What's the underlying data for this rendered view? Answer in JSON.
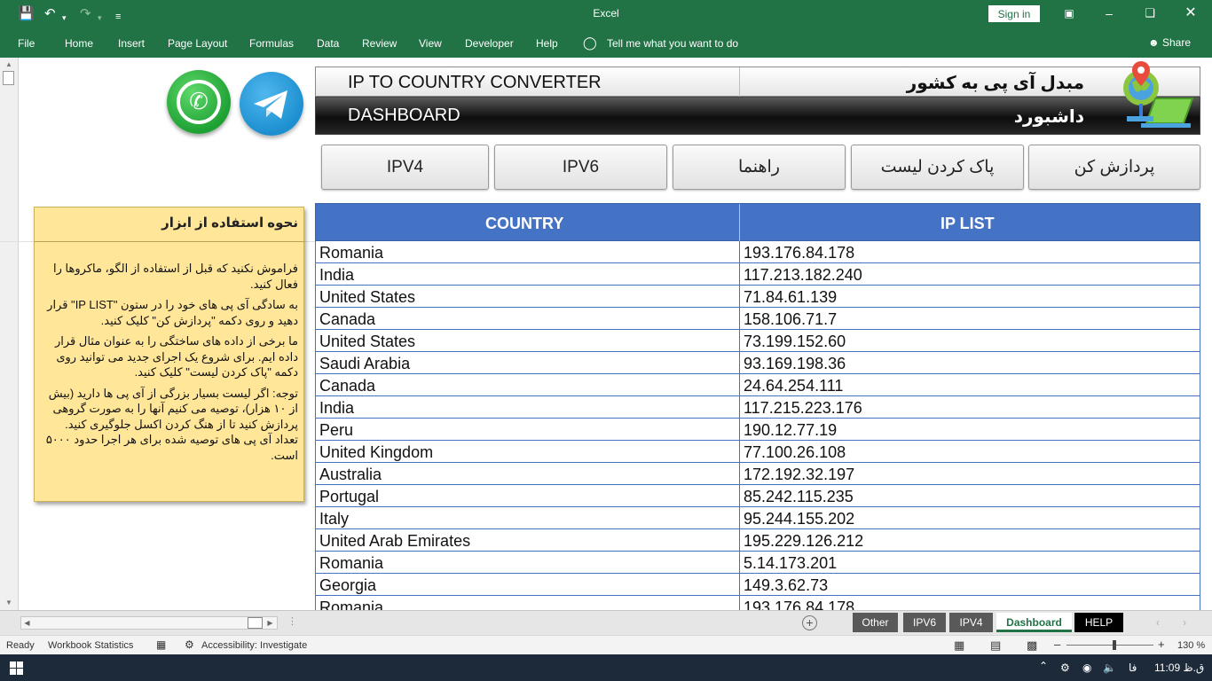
{
  "titlebar": {
    "app_title": "Excel",
    "signin_label": "Sign in"
  },
  "ribbon": {
    "tabs": [
      "File",
      "Home",
      "Insert",
      "Page Layout",
      "Formulas",
      "Data",
      "Review",
      "View",
      "Developer",
      "Help"
    ],
    "tell_me": "Tell me what you want to do",
    "share": "Share"
  },
  "header": {
    "title_en": "IP TO COUNTRY CONVERTER",
    "title_fa": "مبدل آی پی به کشور",
    "dashboard_en": "DASHBOARD",
    "dashboard_fa": "داشبورد"
  },
  "buttons": {
    "ipv4": "IPV4",
    "ipv6": "IPV6",
    "guide": "راهنما",
    "clear_list": "پاک کردن لیست",
    "process": "پردازش کن"
  },
  "help": {
    "title": "نحوه استفاده از ابزار",
    "p1": "فراموش نکنید که قبل از استفاده از الگو، ماکروها را فعال کنید.",
    "p2": "به سادگی آی پی های خود را در ستون \"IP LIST\" قرار دهید و روی دکمه \"پردازش کن\" کلیک کنید.",
    "p3": "ما برخی از داده های ساختگی را به عنوان مثال قرار داده ایم. برای شروع یک اجرای جدید می توانید روی دکمه \"پاک کردن لیست\" کلیک کنید.",
    "p4": "توجه: اگر لیست بسیار بزرگی از آی پی  ها دارید (بیش از ۱۰ هزار)، توصیه می کنیم آنها را به صورت گروهی پردازش کنید تا از هنگ کردن اکسل جلوگیری کنید. تعداد آی پی  های توصیه شده برای هر اجرا حدود ۵۰۰۰ است."
  },
  "table": {
    "col_country": "COUNTRY",
    "col_ip": "IP LIST",
    "rows": [
      {
        "country": "Romania",
        "ip": "193.176.84.178"
      },
      {
        "country": "India",
        "ip": "117.213.182.240"
      },
      {
        "country": "United States",
        "ip": "71.84.61.139"
      },
      {
        "country": "Canada",
        "ip": "158.106.71.7"
      },
      {
        "country": "United States",
        "ip": "73.199.152.60"
      },
      {
        "country": "Saudi Arabia",
        "ip": "93.169.198.36"
      },
      {
        "country": "Canada",
        "ip": "24.64.254.111"
      },
      {
        "country": "India",
        "ip": "117.215.223.176"
      },
      {
        "country": "Peru",
        "ip": "190.12.77.19"
      },
      {
        "country": "United Kingdom",
        "ip": "77.100.26.108"
      },
      {
        "country": "Australia",
        "ip": "172.192.32.197"
      },
      {
        "country": "Portugal",
        "ip": "85.242.115.235"
      },
      {
        "country": "Italy",
        "ip": "95.244.155.202"
      },
      {
        "country": "United Arab Emirates",
        "ip": "195.229.126.212"
      },
      {
        "country": "Romania",
        "ip": "5.14.173.201"
      },
      {
        "country": "Georgia",
        "ip": "149.3.62.73"
      },
      {
        "country": "Romania",
        "ip": "193.176.84.178"
      }
    ]
  },
  "sheet_tabs": {
    "other": "Other",
    "ipv6": "IPV6",
    "ipv4": "IPV4",
    "dashboard": "Dashboard",
    "help": "HELP"
  },
  "statusbar": {
    "ready": "Ready",
    "workbook_stats": "Workbook Statistics",
    "accessibility": "Accessibility: Investigate",
    "zoom": "130 %"
  },
  "taskbar": {
    "lang": "فا",
    "clock": "11:09 ق.ظ"
  },
  "colors": {
    "excel_green": "#217346",
    "table_header": "#4472c4",
    "help_box": "#ffe699"
  }
}
